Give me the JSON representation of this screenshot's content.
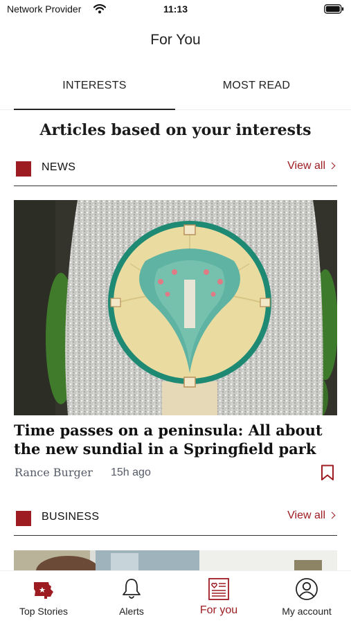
{
  "status_bar": {
    "carrier": "Network Provider",
    "time": "11:13",
    "wifi_icon": "wifi-icon",
    "battery_icon": "battery-icon"
  },
  "header": {
    "title": "For You"
  },
  "tabs": [
    {
      "label": "INTERESTS",
      "selected": true
    },
    {
      "label": "MOST READ",
      "selected": false
    }
  ],
  "section_heading": "Articles based on your interests",
  "categories": [
    {
      "label": "NEWS",
      "view_all": "View all",
      "article": {
        "headline": "Time passes on a peninsula: All about the new sundial in a Springfield park",
        "author": "Rance Burger",
        "time_ago": "15h ago",
        "bookmark_icon": "bookmark-icon"
      }
    },
    {
      "label": "BUSINESS",
      "view_all": "View all"
    }
  ],
  "bottom_nav": [
    {
      "label": "Top Stories",
      "icon": "missouri-state-icon",
      "active": false
    },
    {
      "label": "Alerts",
      "icon": "bell-icon",
      "active": false
    },
    {
      "label": "For you",
      "icon": "newspaper-heart-icon",
      "active": true
    },
    {
      "label": "My account",
      "icon": "user-circle-icon",
      "active": false
    }
  ],
  "colors": {
    "accent": "#9c1c22",
    "text": "#222222",
    "background": "#ffffff"
  }
}
